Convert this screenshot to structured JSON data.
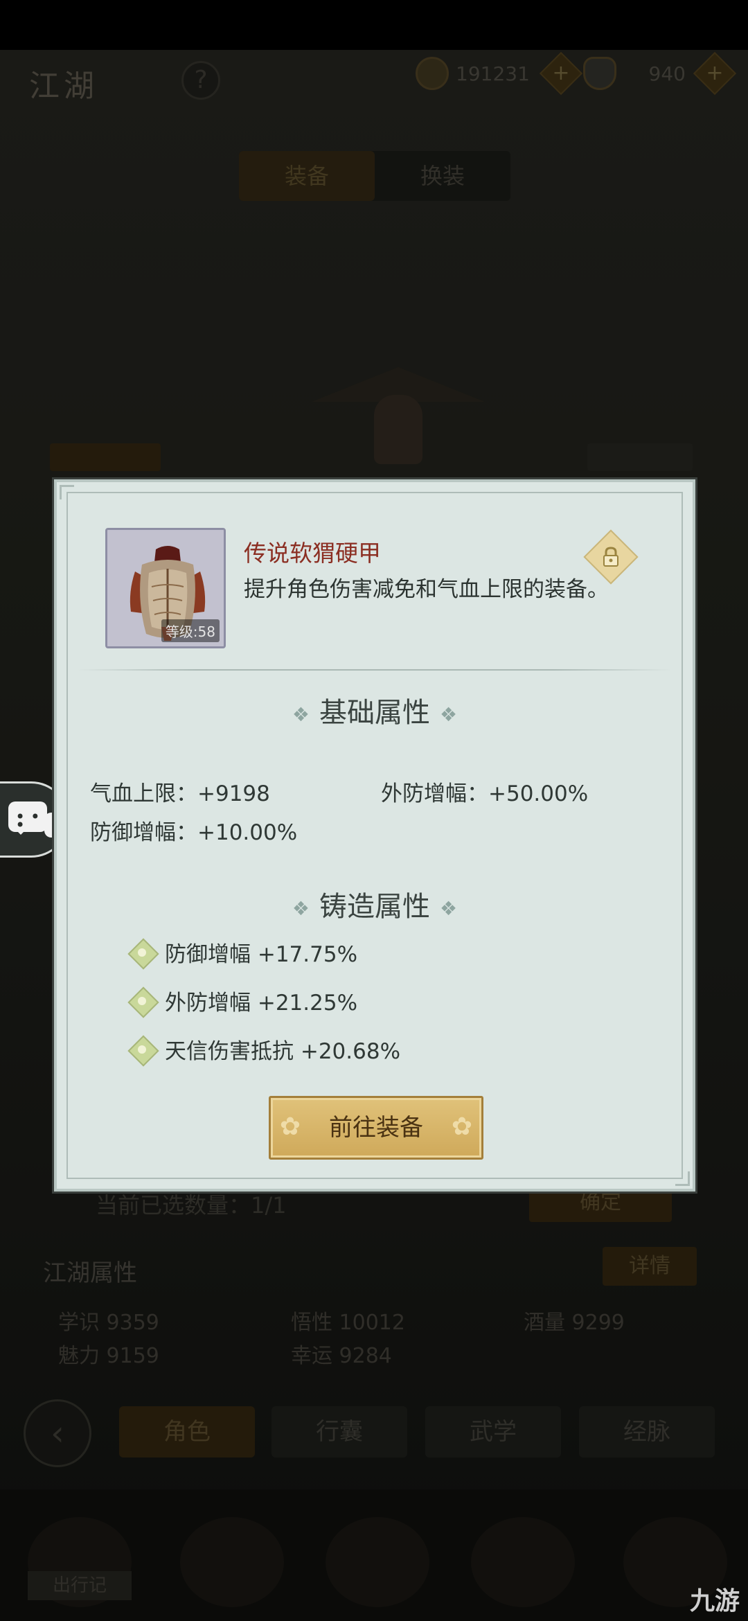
{
  "background": {
    "title": "江湖",
    "help_label": "?",
    "currency": [
      {
        "icon": "coin-icon",
        "value": "191231",
        "plus": "+"
      },
      {
        "icon": "ingot-icon",
        "value": "940",
        "plus": "+"
      }
    ],
    "top_tabs": [
      {
        "label": "装备",
        "active": true
      },
      {
        "label": "换装",
        "active": false
      }
    ],
    "selected_count_text": "当前已选数量：1/1",
    "confirm_label": "确定",
    "attributes_title": "江湖属性",
    "detail_label": "详情",
    "stats": [
      {
        "label": "学识",
        "value": "9359"
      },
      {
        "label": "悟性",
        "value": "10012"
      },
      {
        "label": "酒量",
        "value": "9299"
      },
      {
        "label": "魅力",
        "value": "9159"
      },
      {
        "label": "幸运",
        "value": "9284"
      }
    ],
    "nav_tabs": [
      {
        "label": "角色",
        "active": true
      },
      {
        "label": "行囊",
        "active": false
      },
      {
        "label": "武学",
        "active": false
      },
      {
        "label": "经脉",
        "active": false
      }
    ],
    "travel_label": "出行记",
    "watermark": "九游"
  },
  "modal": {
    "item": {
      "name": "传说软猬硬甲",
      "description": "提升角色伤害减免和气血上限的装备。",
      "level_label": "等级:58"
    },
    "base_section_title": "基础属性",
    "base_attributes": [
      {
        "text": "气血上限：+9198"
      },
      {
        "text": "外防增幅：+50.00%"
      },
      {
        "text": "防御增幅：+10.00%"
      }
    ],
    "forge_section_title": "铸造属性",
    "forge_attributes": [
      {
        "text": "防御增幅 +17.75%"
      },
      {
        "text": "外防增幅 +21.25%"
      },
      {
        "text": "天信伤害抵抗 +20.68%"
      }
    ],
    "go_equip_label": "前往装备"
  },
  "colors": {
    "modal_bg": "#dce6e3",
    "item_name": "#8b2e22",
    "button_gold": "#d6b468"
  }
}
